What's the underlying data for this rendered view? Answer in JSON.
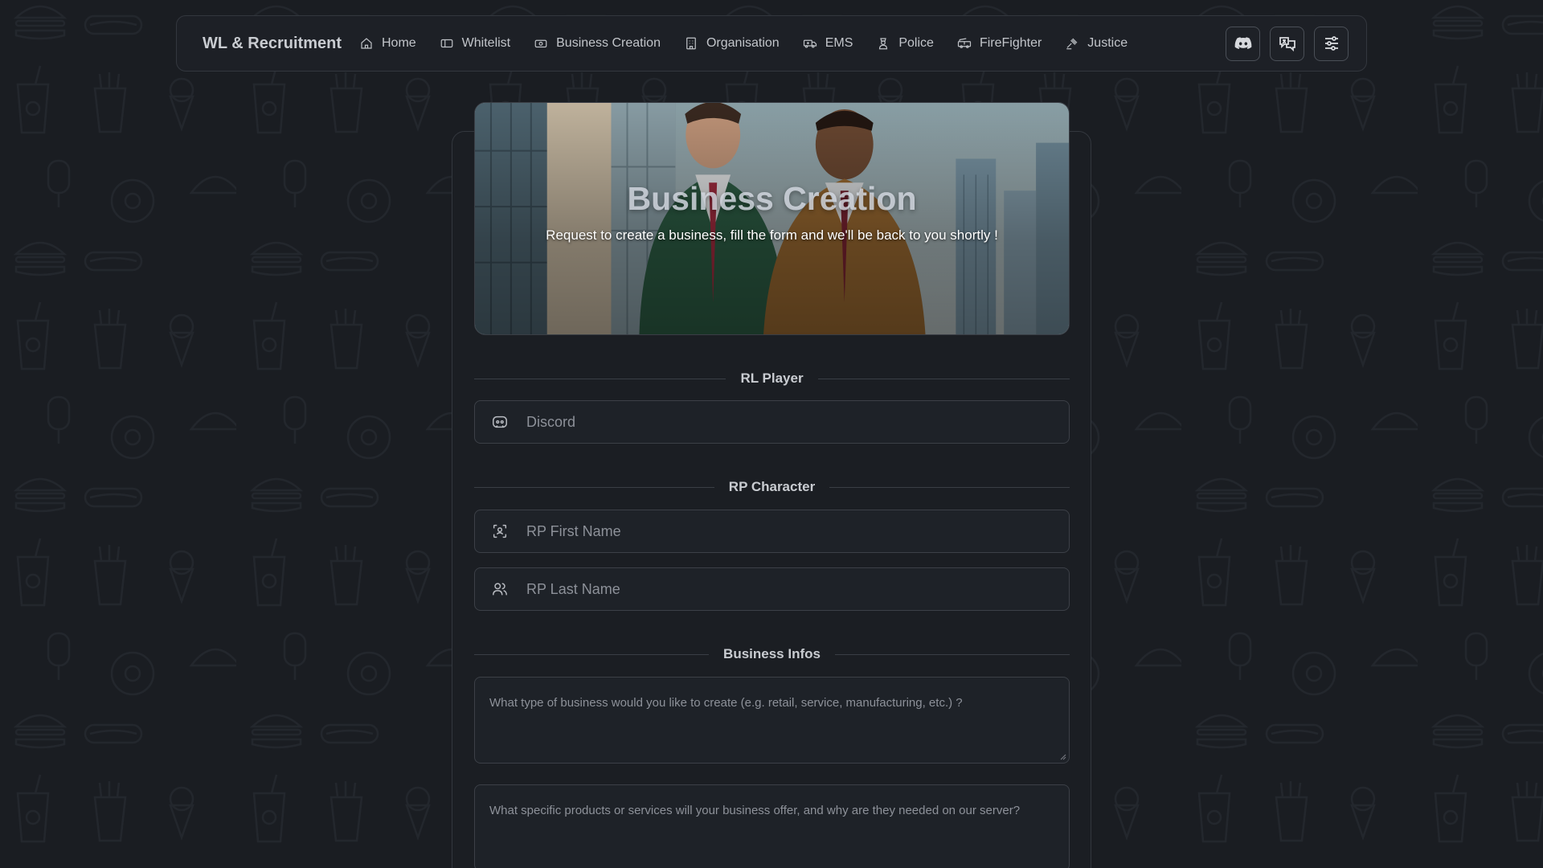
{
  "nav": {
    "brand": "WL & Recruitment",
    "items": [
      {
        "label": "Home",
        "icon": "home-icon"
      },
      {
        "label": "Whitelist",
        "icon": "ticket-icon"
      },
      {
        "label": "Business Creation",
        "icon": "banknote-icon"
      },
      {
        "label": "Organisation",
        "icon": "building-icon"
      },
      {
        "label": "EMS",
        "icon": "ambulance-icon"
      },
      {
        "label": "Police",
        "icon": "police-officer-icon"
      },
      {
        "label": "FireFighter",
        "icon": "fire-truck-icon"
      },
      {
        "label": "Justice",
        "icon": "gavel-icon"
      }
    ],
    "actions": [
      {
        "icon": "discord-icon"
      },
      {
        "icon": "language-translate-icon"
      },
      {
        "icon": "settings-sliders-icon"
      }
    ]
  },
  "hero": {
    "title": "Business Creation",
    "subtitle": "Request to create a business, fill the form and we'll be back to you shortly !"
  },
  "sections": {
    "rl_player": "RL Player",
    "rp_character": "RP Character",
    "business_infos": "Business Infos"
  },
  "fields": {
    "discord": {
      "placeholder": "Discord",
      "value": "",
      "icon": "discord-icon"
    },
    "rp_first_name": {
      "placeholder": "RP First Name",
      "value": "",
      "icon": "face-scan-icon"
    },
    "rp_last_name": {
      "placeholder": "RP Last Name",
      "value": "",
      "icon": "users-icon"
    },
    "business_type": {
      "placeholder": "What type of business would you like to create (e.g. retail, service, manufacturing, etc.) ?",
      "value": ""
    },
    "business_offer": {
      "placeholder": "What specific products or services will your business offer, and why are they needed on our server?",
      "value": ""
    }
  },
  "colors": {
    "background": "#1a1d22",
    "card": "#1b1e23",
    "border": "#3c4047",
    "text": "#d4d6da",
    "placeholder": "#8d9199"
  }
}
